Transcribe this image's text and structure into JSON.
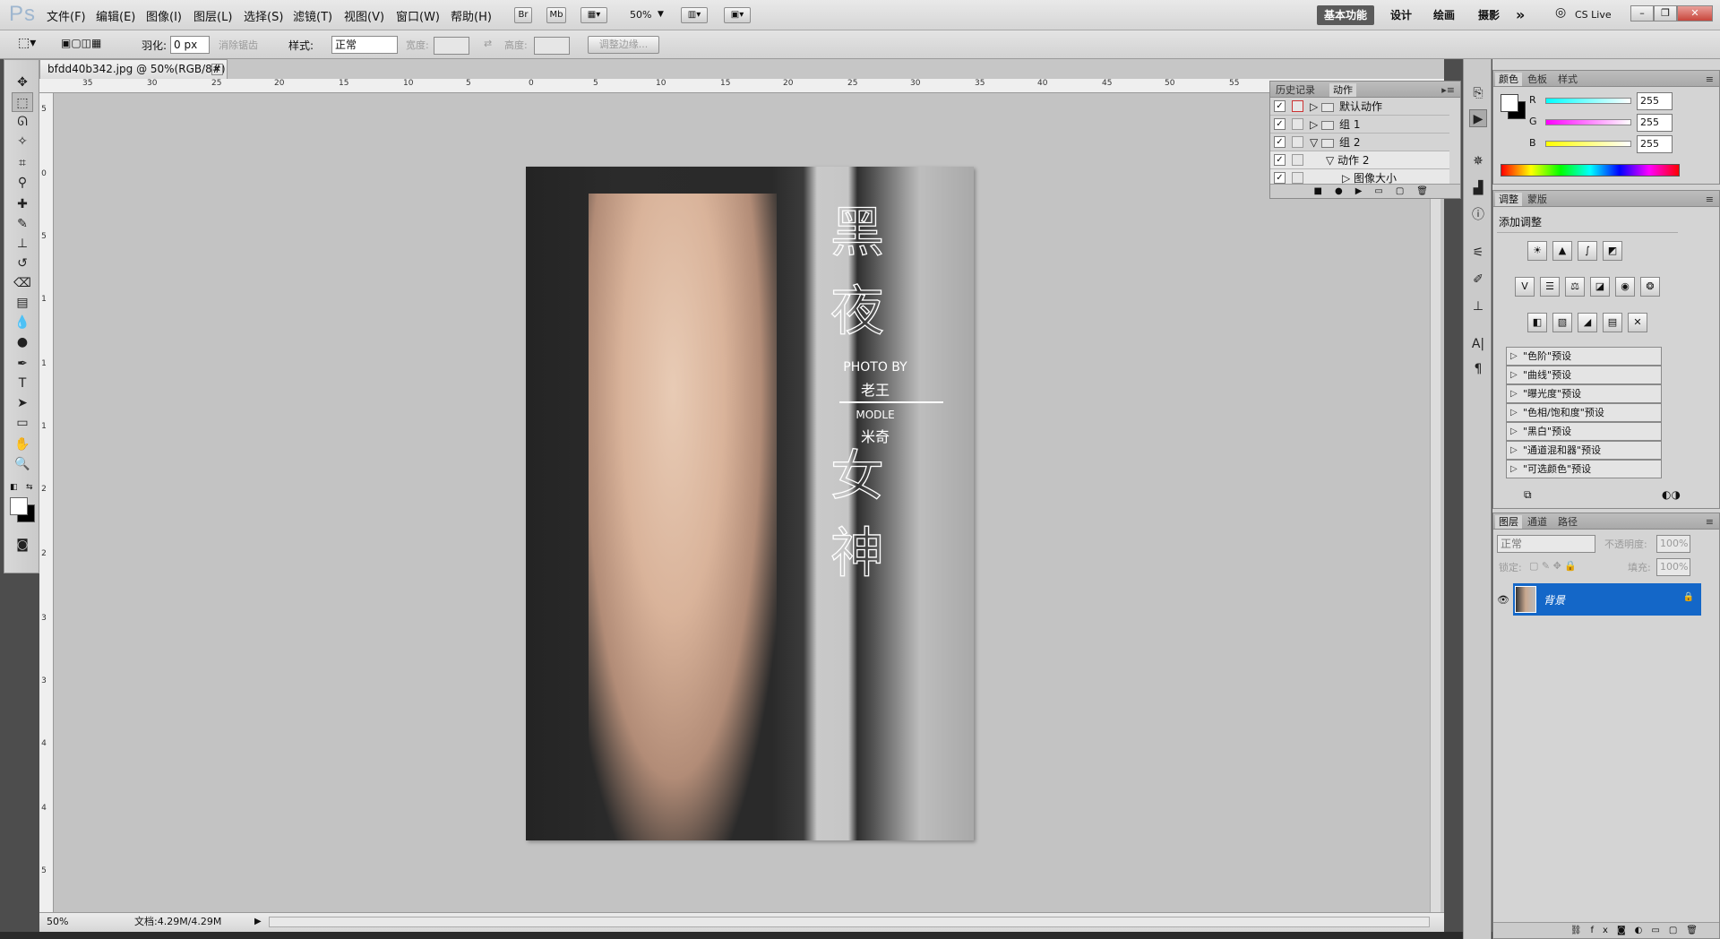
{
  "app": {
    "logo": "Ps",
    "doc_title": "bfdd40b342.jpg @ 50%(RGB/8#)"
  },
  "menu": [
    "文件(F)",
    "编辑(E)",
    "图像(I)",
    "图层(L)",
    "选择(S)",
    "滤镜(T)",
    "视图(V)",
    "窗口(W)",
    "帮助(H)"
  ],
  "appbar": {
    "br": "Br",
    "mb": "Mb",
    "zoom": "50%"
  },
  "workspaces": [
    "基本功能",
    "设计",
    "绘画",
    "摄影"
  ],
  "cslive": "CS Live",
  "options": {
    "feather_label": "羽化:",
    "feather_value": "0 px",
    "antialias": "消除锯齿",
    "style_label": "样式:",
    "style_value": "正常",
    "width_label": "宽度:",
    "height_label": "高度:",
    "refine_edge": "调整边缘..."
  },
  "ruler_top": [
    "35",
    "30",
    "25",
    "20",
    "15",
    "10",
    "5",
    "0",
    "5",
    "10",
    "15",
    "20",
    "25",
    "30",
    "35",
    "40",
    "45",
    "50",
    "55"
  ],
  "ruler_left": [
    "5",
    "0",
    "5",
    "1",
    "1",
    "1",
    "2",
    "2",
    "3",
    "3",
    "4",
    "4",
    "5",
    "5"
  ],
  "poster": {
    "char1": "黑",
    "char2": "夜",
    "photo_by": "PHOTO BY",
    "photographer": "老王",
    "modle": "MODLE",
    "model": "米奇",
    "char3": "女",
    "char4": "神"
  },
  "status": {
    "zoom": "50%",
    "doc": "文档:4.29M/4.29M"
  },
  "actions_panel": {
    "tabs": [
      "历史记录",
      "动作"
    ],
    "rows": [
      "默认动作",
      "组 1",
      "组 2",
      "动作 2",
      "图像大小"
    ]
  },
  "color_panel": {
    "tabs": [
      "颜色",
      "色板",
      "样式"
    ],
    "r_label": "R",
    "g_label": "G",
    "b_label": "B",
    "r": "255",
    "g": "255",
    "b": "255"
  },
  "adjust_panel": {
    "tabs": [
      "调整",
      "蒙版"
    ],
    "title": "添加调整",
    "presets": [
      "\"色阶\"预设",
      "\"曲线\"预设",
      "\"曝光度\"预设",
      "\"色相/饱和度\"预设",
      "\"黑白\"预设",
      "\"通道混和器\"预设",
      "\"可选颜色\"预设"
    ]
  },
  "layers_panel": {
    "tabs": [
      "图层",
      "通道",
      "路径"
    ],
    "blend": "正常",
    "opacity_label": "不透明度:",
    "opacity": "100%",
    "lock_label": "锁定:",
    "fill_label": "填充:",
    "fill": "100%",
    "layer_name": "背景"
  }
}
